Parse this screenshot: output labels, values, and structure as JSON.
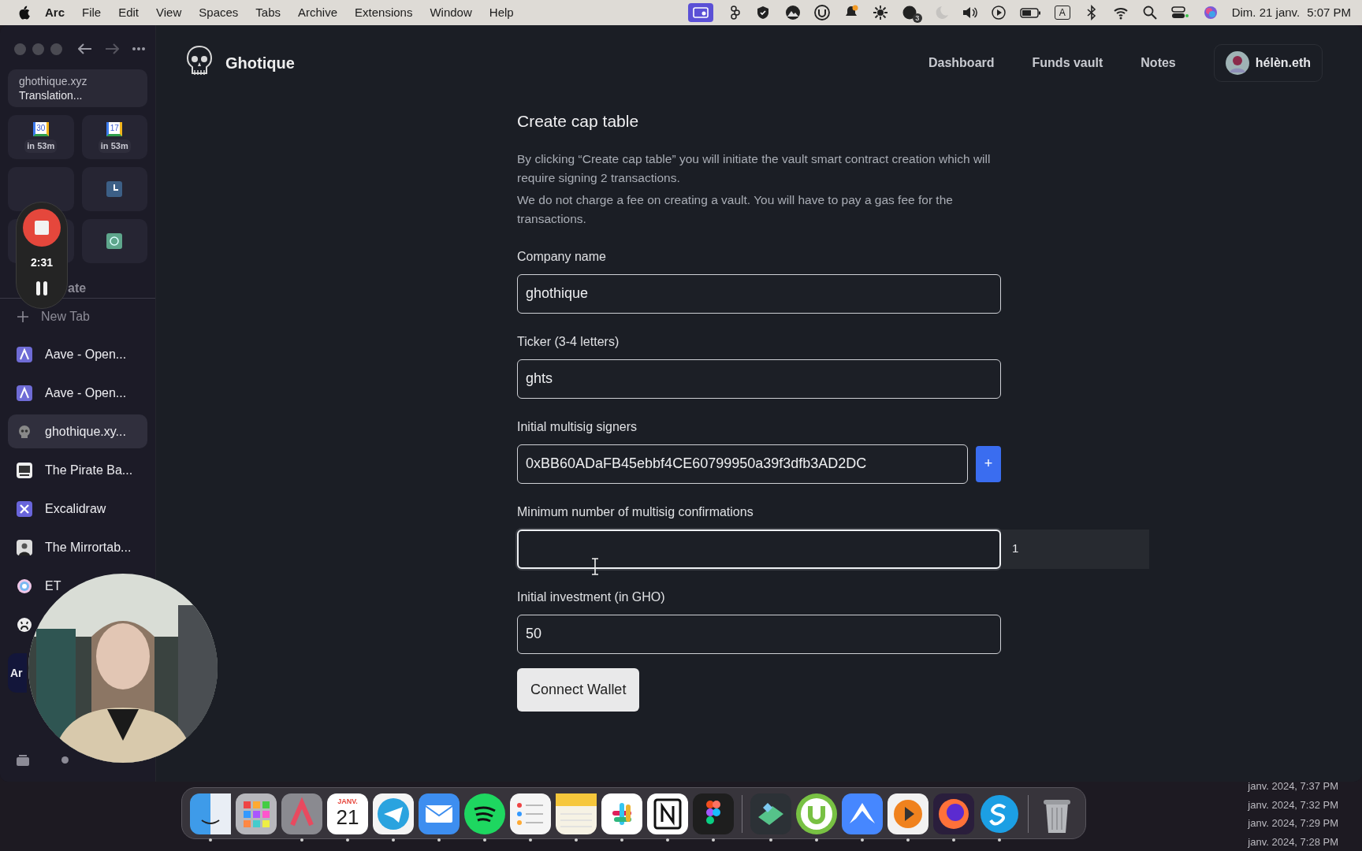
{
  "menu_bar": {
    "menus": [
      "Arc",
      "File",
      "Edit",
      "View",
      "Spaces",
      "Tabs",
      "Archive",
      "Extensions",
      "Window",
      "Help"
    ],
    "notification_count": "3",
    "input_source": "A",
    "date": "Dim. 21 janv.",
    "time": "5:07 PM"
  },
  "sidebar": {
    "pinned": {
      "title": "ghothique.xyz",
      "subtitle": "Translation..."
    },
    "tiles": [
      {
        "kind": "calendar",
        "date": "30",
        "label": "in 53m"
      },
      {
        "kind": "calendar",
        "date": "17",
        "label": "in 53m"
      },
      {
        "kind": "blank"
      },
      {
        "kind": "clock"
      },
      {
        "kind": "blank"
      },
      {
        "kind": "chat"
      }
    ],
    "section_label": "ate",
    "new_tab": "New Tab",
    "tabs": [
      {
        "kind": "aave",
        "label": "Aave - Open...",
        "selected": false
      },
      {
        "kind": "aave",
        "label": "Aave - Open...",
        "selected": false
      },
      {
        "kind": "skull",
        "label": "ghothique.xy...",
        "selected": true
      },
      {
        "kind": "pirate",
        "label": "The Pirate Ba...",
        "selected": false
      },
      {
        "kind": "excalidraw",
        "label": "Excalidraw",
        "selected": false
      },
      {
        "kind": "mirror",
        "label": "The Mirrortab...",
        "selected": false
      },
      {
        "kind": "eth",
        "label": "ET",
        "selected": false
      },
      {
        "kind": "github",
        "selected": false
      }
    ],
    "space_label": "Ar"
  },
  "recorder": {
    "time": "2:31"
  },
  "webcam": {
    "kind": "picture"
  },
  "app": {
    "brand": "Ghotique",
    "nav": [
      "Dashboard",
      "Funds vault",
      "Notes"
    ],
    "user": "hélèn.eth"
  },
  "form": {
    "title": "Create cap table",
    "paragraphs": [
      "By clicking “Create cap table” you will initiate the vault smart contract creation which will require signing 2 transactions.",
      "We do not charge a fee on creating a vault. You will have to pay a gas fee for the transactions."
    ],
    "fields": [
      {
        "kind": "text",
        "label": "Company name",
        "value": "ghothique",
        "focused": false
      },
      {
        "kind": "text",
        "label": "Ticker (3-4 letters)",
        "value": "ghts",
        "focused": false
      },
      {
        "kind": "address",
        "label": "Initial multisig signers",
        "value": "0xBB60ADaFB45ebbf4CE60799950a39f3dfb3AD2DC",
        "focused": false,
        "add_button": "+"
      },
      {
        "kind": "number",
        "label": "Minimum number of multisig confirmations",
        "focused": true,
        "stepper": "1"
      },
      {
        "kind": "text",
        "label": "Initial investment (in GHO)",
        "value": "50",
        "focused": false
      }
    ],
    "submit": "Connect Wallet"
  },
  "dock": [
    {
      "kind": "finder",
      "running": true
    },
    {
      "kind": "launchpad",
      "running": false
    },
    {
      "kind": "arc",
      "running": true
    },
    {
      "kind": "calendar",
      "month": "JANV.",
      "day": "21",
      "running": true
    },
    {
      "kind": "telegram",
      "running": true
    },
    {
      "kind": "mail",
      "running": true
    },
    {
      "kind": "spotify",
      "running": true
    },
    {
      "kind": "reminders",
      "running": true
    },
    {
      "kind": "notes",
      "running": true
    },
    {
      "kind": "slack",
      "running": true
    },
    {
      "kind": "notion",
      "running": true
    },
    {
      "kind": "figma",
      "running": true
    },
    {
      "kind": "separator"
    },
    {
      "kind": "cash",
      "running": true
    },
    {
      "kind": "torrent",
      "running": true
    },
    {
      "kind": "vpn",
      "running": true
    },
    {
      "kind": "player",
      "running": true
    },
    {
      "kind": "firefox",
      "running": true
    },
    {
      "kind": "skype",
      "running": true
    },
    {
      "kind": "separator"
    },
    {
      "kind": "trash",
      "running": false
    }
  ],
  "desktop_list": [
    "janv. 2024, 7:37 PM",
    "janv. 2024, 7:32 PM",
    "janv. 2024, 7:29 PM",
    "janv. 2024, 7:28 PM"
  ]
}
